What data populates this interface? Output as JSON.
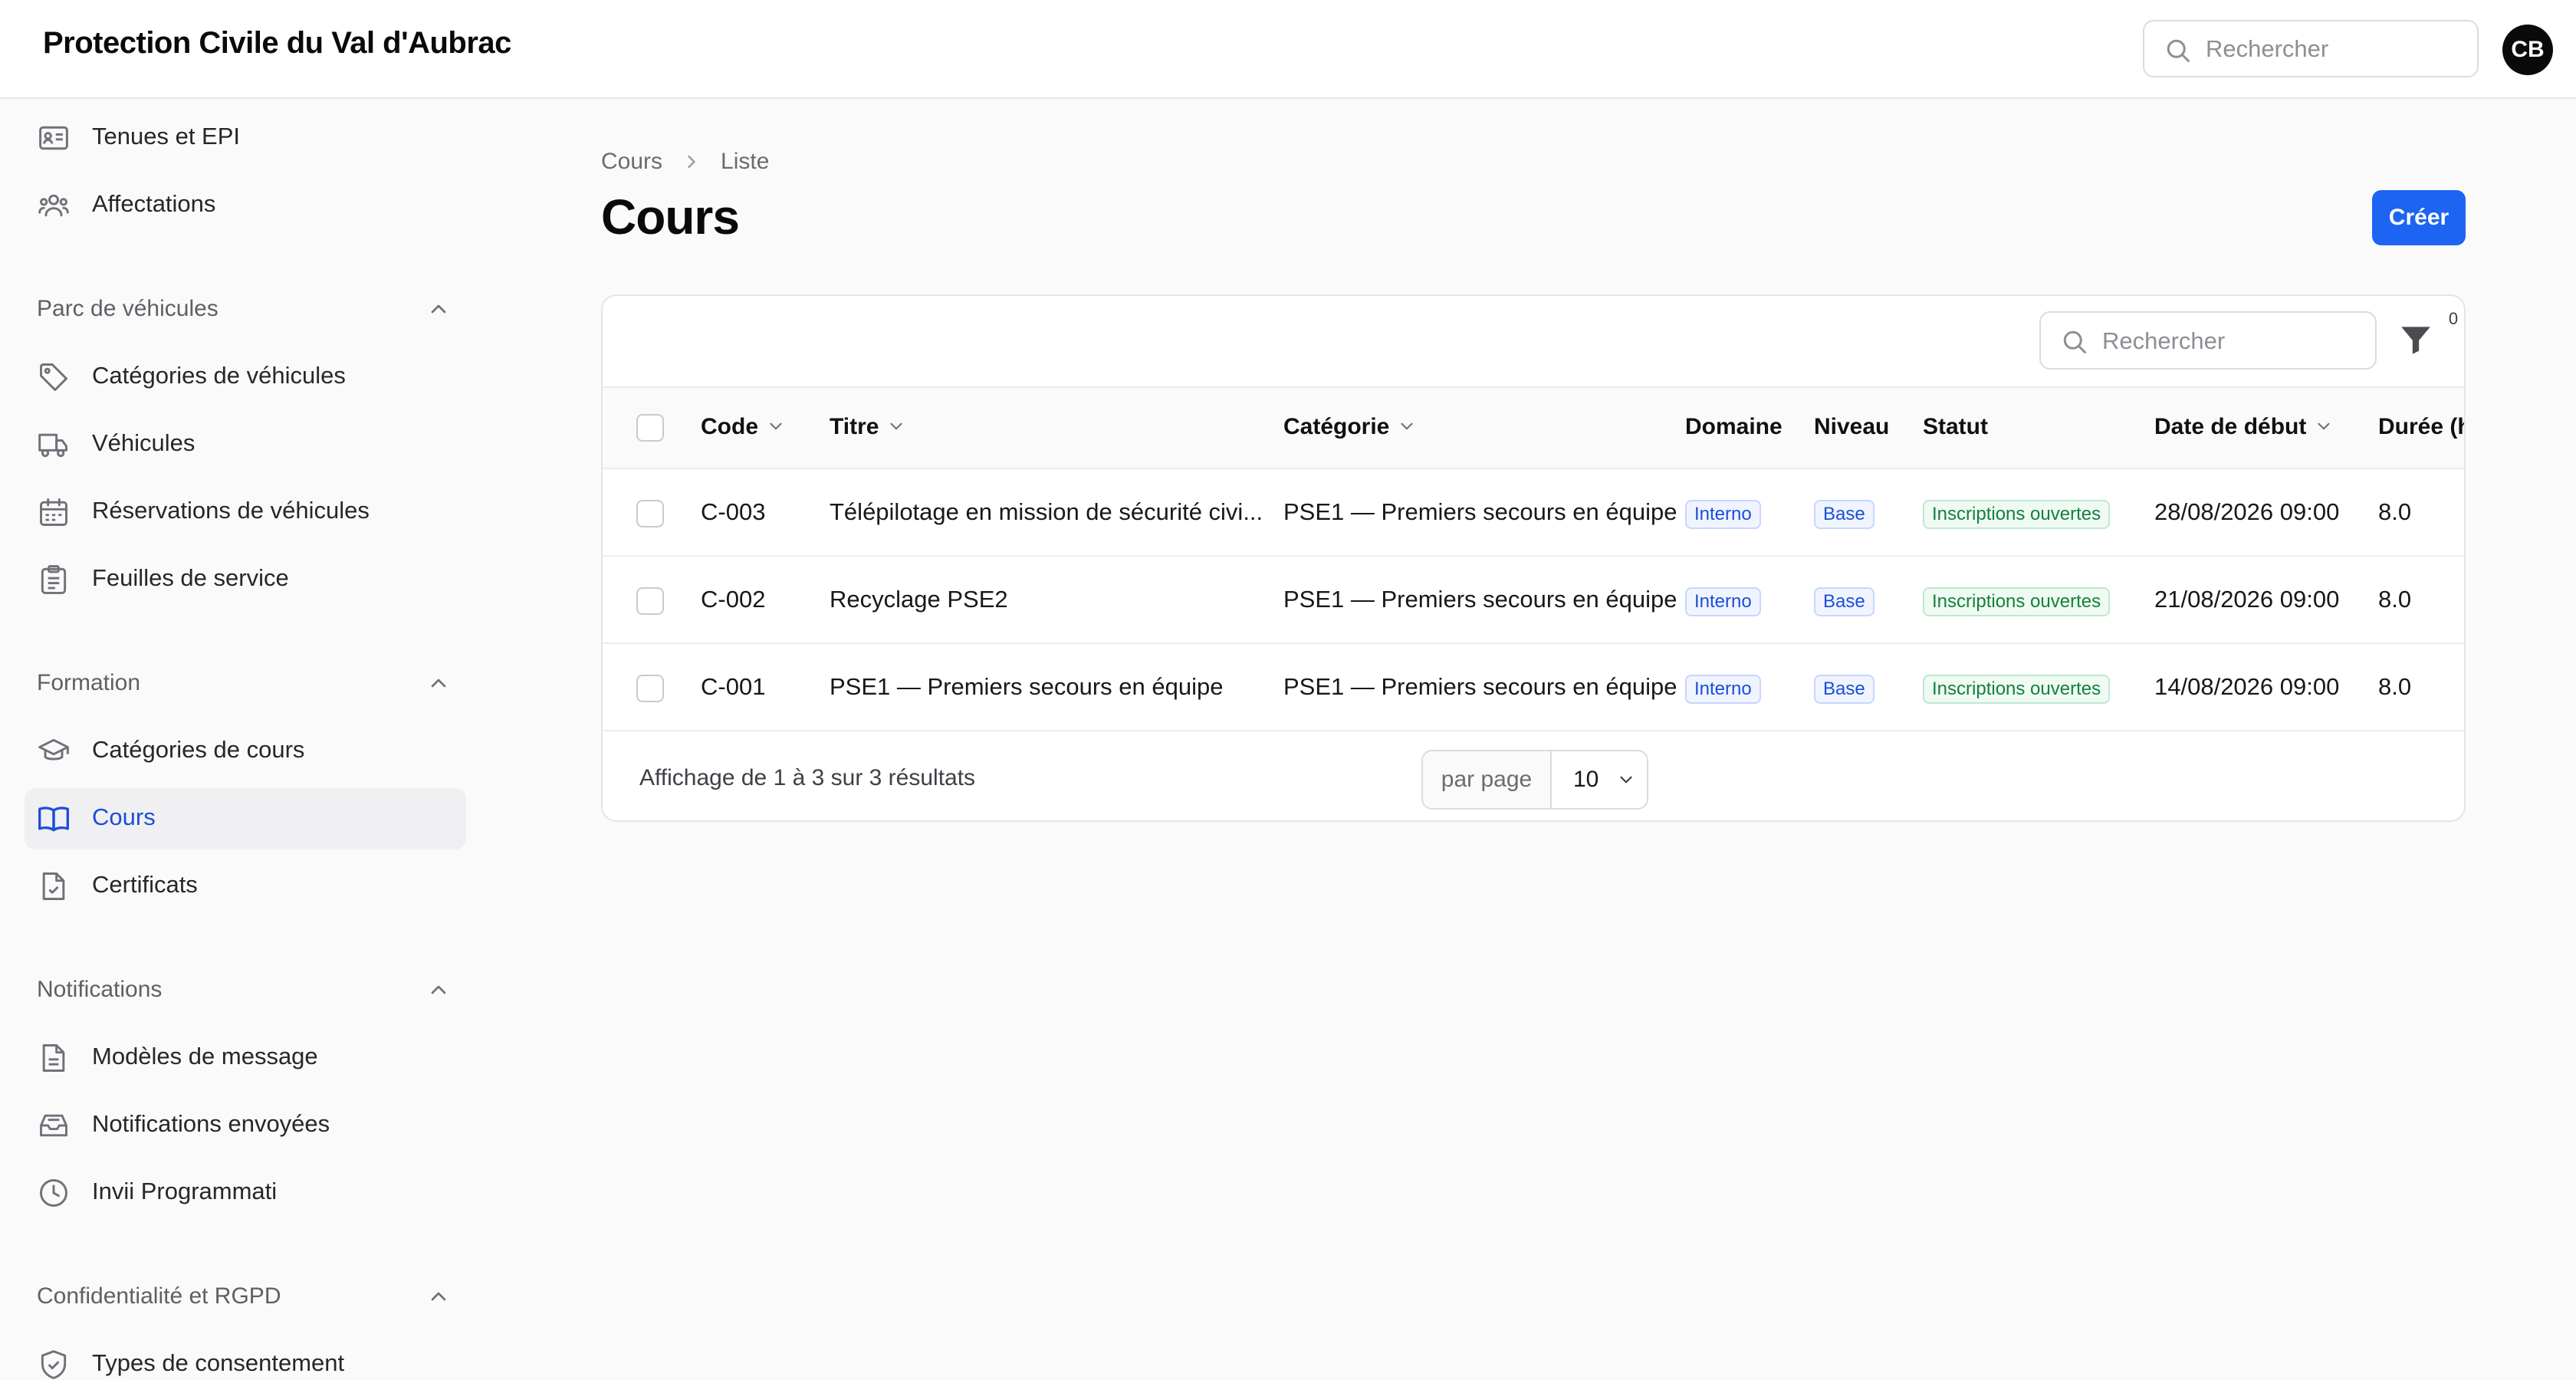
{
  "app": {
    "title": "Protection Civile du Val d'Aubrac",
    "search_placeholder": "Rechercher",
    "user_initials": "CB"
  },
  "sidebar": {
    "items_top": [
      {
        "label": "Tenues et EPI",
        "icon": "id-card-icon"
      },
      {
        "label": "Affectations",
        "icon": "users-icon"
      }
    ],
    "groups": [
      {
        "label": "Parc de véhicules",
        "items": [
          {
            "label": "Catégories de véhicules",
            "icon": "tag-icon"
          },
          {
            "label": "Véhicules",
            "icon": "truck-icon"
          },
          {
            "label": "Réservations de véhicules",
            "icon": "calendar-icon"
          },
          {
            "label": "Feuilles de service",
            "icon": "clipboard-icon"
          }
        ]
      },
      {
        "label": "Formation",
        "items": [
          {
            "label": "Catégories de cours",
            "icon": "graduation-cap-icon"
          },
          {
            "label": "Cours",
            "icon": "book-open-icon",
            "active": true
          },
          {
            "label": "Certificats",
            "icon": "document-check-icon"
          }
        ]
      },
      {
        "label": "Notifications",
        "items": [
          {
            "label": "Modèles de message",
            "icon": "document-text-icon"
          },
          {
            "label": "Notifications envoyées",
            "icon": "inbox-icon"
          },
          {
            "label": "Invii Programmati",
            "icon": "clock-icon"
          }
        ]
      },
      {
        "label": "Confidentialité et RGPD",
        "items": [
          {
            "label": "Types de consentement",
            "icon": "shield-check-icon"
          }
        ]
      }
    ]
  },
  "breadcrumb": [
    "Cours",
    "Liste"
  ],
  "page": {
    "title": "Cours",
    "create_label": "Créer"
  },
  "table": {
    "search_placeholder": "Rechercher",
    "filter_count": "0",
    "columns": [
      "Code",
      "Titre",
      "Catégorie",
      "Domaine",
      "Niveau",
      "Statut",
      "Date de début",
      "Durée (h"
    ],
    "rows": [
      {
        "code": "C-003",
        "titre": "Télépilotage en mission de sécurité civi...",
        "categorie": "PSE1 — Premiers secours en équipe",
        "domaine": "Interno",
        "niveau": "Base",
        "statut": "Inscriptions ouvertes",
        "date": "28/08/2026 09:00",
        "duree": "8.0"
      },
      {
        "code": "C-002",
        "titre": "Recyclage PSE2",
        "categorie": "PSE1 — Premiers secours en équipe",
        "domaine": "Interno",
        "niveau": "Base",
        "statut": "Inscriptions ouvertes",
        "date": "21/08/2026 09:00",
        "duree": "8.0"
      },
      {
        "code": "C-001",
        "titre": "PSE1 — Premiers secours en équipe",
        "categorie": "PSE1 — Premiers secours en équipe",
        "domaine": "Interno",
        "niveau": "Base",
        "statut": "Inscriptions ouvertes",
        "date": "14/08/2026 09:00",
        "duree": "8.0"
      }
    ],
    "summary": "Affichage de 1 à 3 sur 3 résultats",
    "per_page_label": "par page",
    "per_page_value": "10"
  },
  "colors": {
    "accent": "#1d64f2",
    "active_text": "#1d4ed8",
    "badge_blue": "#1d4ed8",
    "badge_green": "#15803d"
  }
}
